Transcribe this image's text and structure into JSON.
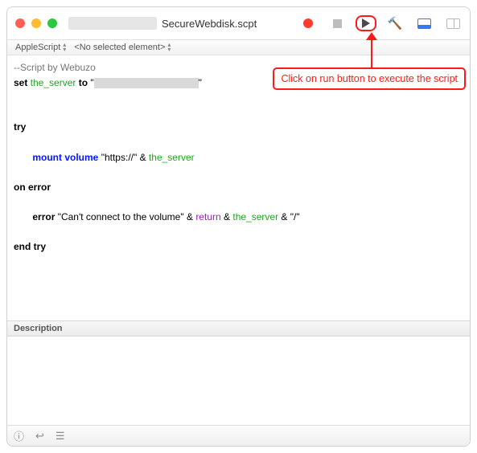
{
  "titlebar": {
    "filename": "SecureWebdisk.scpt"
  },
  "navbar": {
    "language": "AppleScript",
    "element": "<No selected element>"
  },
  "code": {
    "comment": "--Script by Webuzo",
    "set": "set",
    "var_server": "the_server",
    "to": "to",
    "try": "try",
    "mount": "mount volume",
    "url_prefix": "\"https://\"",
    "amp": "&",
    "on_error": "on error",
    "error_kw": "error",
    "err_msg": "\"Can't connect to the volume\"",
    "return_kw": "return",
    "slash": "\"/\"",
    "end_try": "end try"
  },
  "description": {
    "label": "Description"
  },
  "callout": {
    "text": "Click on run button to execute the script"
  }
}
